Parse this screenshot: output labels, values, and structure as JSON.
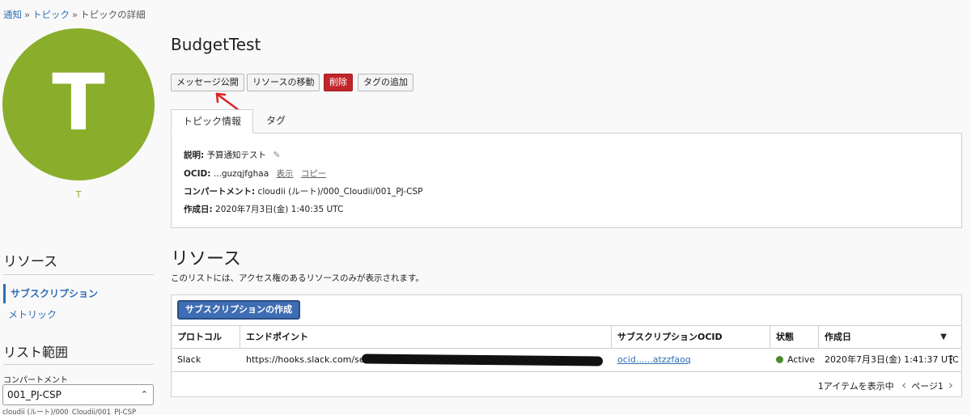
{
  "breadcrumb": {
    "items": [
      "通知",
      "トピック",
      "トピックの詳細"
    ],
    "separator": "»"
  },
  "avatar": {
    "letter": "T",
    "caption": "T",
    "color": "#8aad2c"
  },
  "sidebar": {
    "resources_heading": "リソース",
    "items": [
      {
        "label": "サブスクリプション",
        "active": true
      },
      {
        "label": "メトリック",
        "active": false
      }
    ],
    "scope_heading": "リスト範囲",
    "compartment_label": "コンパートメント",
    "compartment_value": "001_PJ-CSP",
    "compartment_path": "cloudii (ルート)/000_Cloudii/001_PJ-CSP"
  },
  "page": {
    "title": "BudgetTest"
  },
  "actions": {
    "publish": "メッセージ公開",
    "move": "リソースの移動",
    "delete": "削除",
    "add_tag": "タグの追加"
  },
  "tabs": [
    "トピック情報",
    "タグ"
  ],
  "info": {
    "desc_label": "説明:",
    "desc_value": "予算通知テスト",
    "ocid_label": "OCID:",
    "ocid_value": "...guzqjfghaa",
    "ocid_show": "表示",
    "ocid_copy": "コピー",
    "compartment_label": "コンパートメント:",
    "compartment_value": "cloudii (ルート)/000_Cloudii/001_PJ-CSP",
    "created_label": "作成日:",
    "created_value": "2020年7月3日(金) 1:40:35 UTC"
  },
  "resources": {
    "title": "リソース",
    "description": "このリストには、アクセス権のあるリソースのみが表示されます。",
    "create_button": "サブスクリプションの作成",
    "columns": [
      "プロトコル",
      "エンドポイント",
      "サブスクリプションOCID",
      "状態",
      "作成日"
    ],
    "rows": [
      {
        "protocol": "Slack",
        "endpoint": "https://hooks.slack.com/services",
        "ocid": "ocid......atzzfaoq",
        "status": "Active",
        "created": "2020年7月3日(金) 1:41:37 UTC"
      }
    ],
    "pager_count": "1アイテムを表示中",
    "pager_page": "ページ1"
  },
  "colors": {
    "accent": "#2f6fb5",
    "danger": "#c0262a",
    "status_active": "#4b8a2d",
    "avatar": "#8aad2c"
  }
}
